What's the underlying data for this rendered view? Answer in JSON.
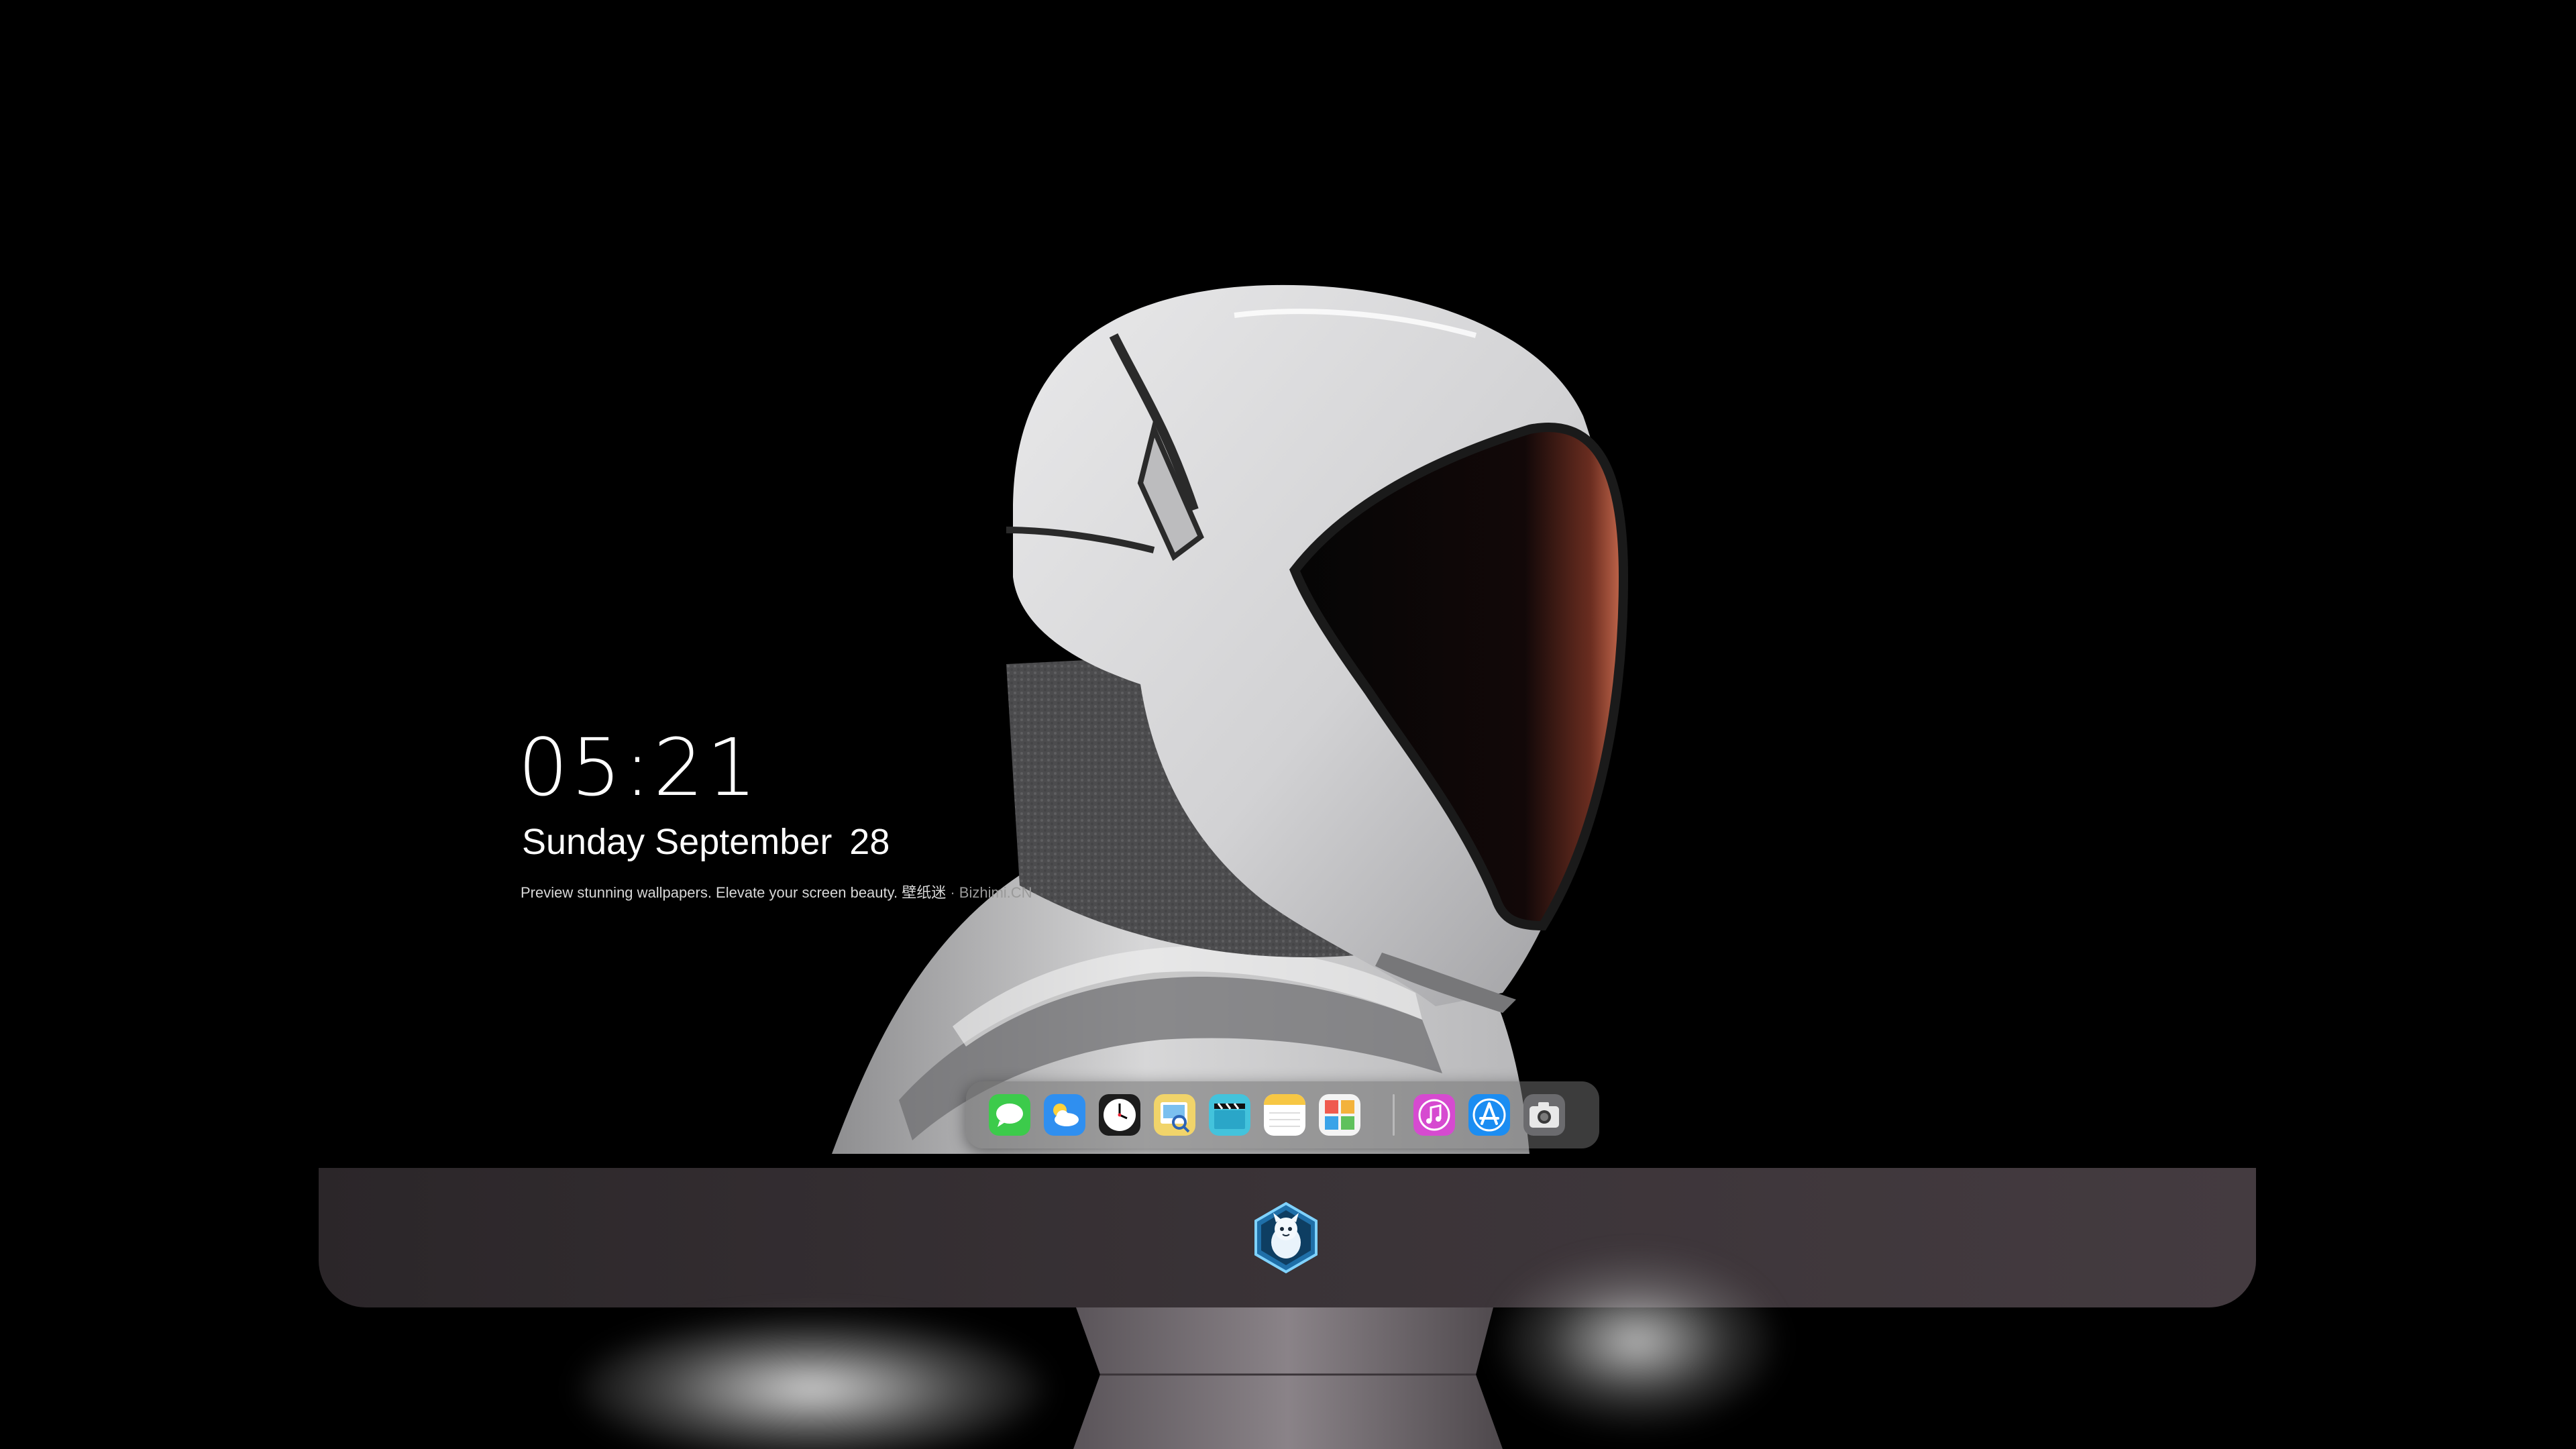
{
  "lockscreen": {
    "time": "05:21",
    "weekday_month": "Sunday September",
    "day": "28",
    "tagline": "Preview stunning wallpapers. Elevate your screen beauty. 壁纸迷",
    "tagline_site": " · Bizhimi.CN"
  },
  "dock": {
    "apps": [
      {
        "name": "Messages",
        "icon": "messages-icon"
      },
      {
        "name": "Weather",
        "icon": "weather-icon"
      },
      {
        "name": "Clock",
        "icon": "clock-icon"
      },
      {
        "name": "Preview",
        "icon": "preview-icon"
      },
      {
        "name": "Video",
        "icon": "clapperboard-icon"
      },
      {
        "name": "Notes",
        "icon": "notes-icon"
      },
      {
        "name": "Photo Booth",
        "icon": "photos-icon"
      }
    ],
    "pinned": [
      {
        "name": "iTunes",
        "icon": "music-icon"
      },
      {
        "name": "App Store",
        "icon": "app-store-icon"
      },
      {
        "name": "Camera",
        "icon": "camera-icon"
      }
    ]
  },
  "taskbar": {
    "logo": "mascot-logo-icon"
  },
  "colors": {
    "background": "#000000",
    "taskbar": "#3a3337",
    "visor_glow": "#c86a4e"
  }
}
